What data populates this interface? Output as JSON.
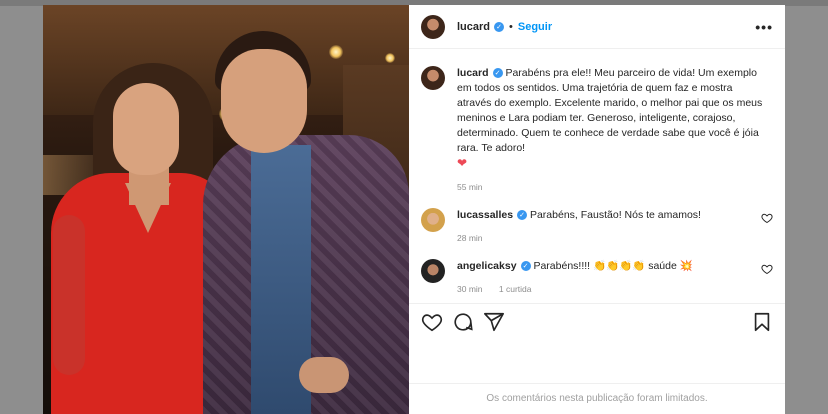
{
  "post": {
    "author": "lucard",
    "follow_label": "Seguir",
    "separator": "•",
    "more_label": "•••"
  },
  "comments": [
    {
      "user": "lucard",
      "text": "Parabéns pra ele!! Meu parceiro de vida! Um exemplo em todos os sentidos. Uma trajetória de quem faz e mostra através do exemplo. Excelente marido, o melhor pai que os meus meninos e Lara podiam ter. Generoso, inteligente, corajoso, determinado. Quem te conhece de verdade sabe que você é jóia rara. Te adoro!",
      "emoji": "❤",
      "time": "55 min",
      "likes": ""
    },
    {
      "user": "lucassalles",
      "text": "Parabéns, Faustão! Nós te amamos!",
      "emoji": "",
      "time": "28 min",
      "likes": ""
    },
    {
      "user": "angelicaksy",
      "text": "Parabéns!!!! 👏👏👏👏 saúde",
      "emoji": "💥",
      "time": "30 min",
      "likes": "1 curtida"
    }
  ],
  "footer": {
    "limited_text": "Os comentários nesta publicação foram limitados."
  },
  "colors": {
    "accent": "#0095f6",
    "verified": "#3897f0",
    "heart": "#ed4956",
    "dress": "#d8261f"
  },
  "icons": [
    "verified-badge-icon",
    "more-options-icon",
    "like-icon",
    "comment-icon",
    "share-icon",
    "save-icon",
    "heart-icon"
  ]
}
